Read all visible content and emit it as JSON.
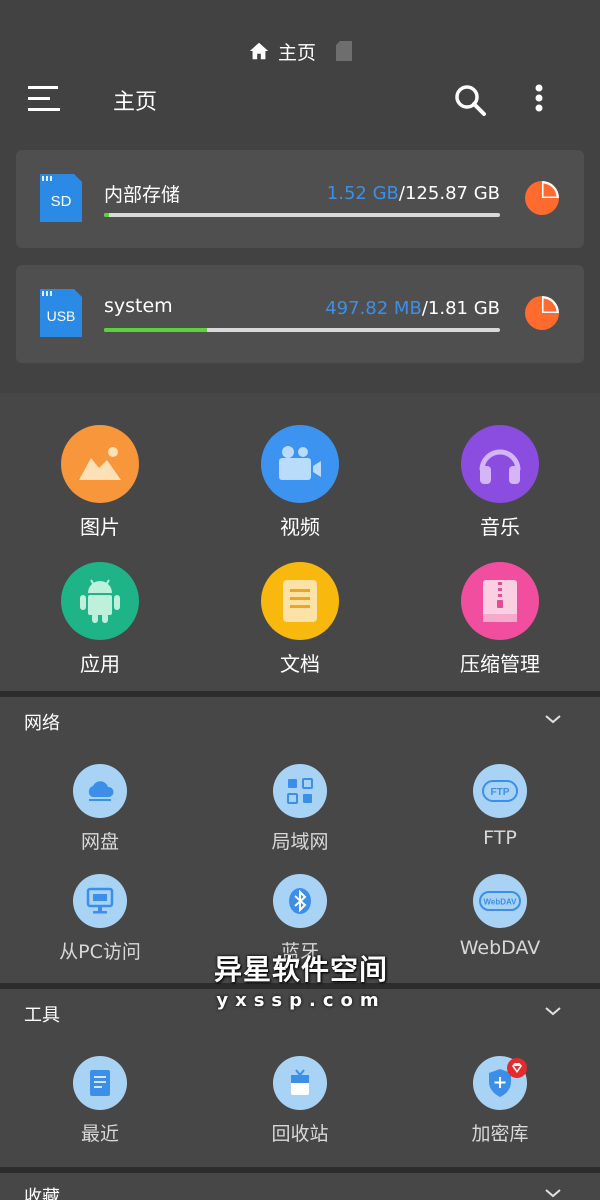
{
  "breadcrumb": {
    "home_label": "主页"
  },
  "toolbar": {
    "title": "主页"
  },
  "storage": [
    {
      "icon_text": "SD",
      "name": "内部存储",
      "used": "1.52 GB",
      "separator": "/",
      "total": "125.87 GB",
      "used_fraction": 0.012
    },
    {
      "icon_text": "USB",
      "name": "system",
      "used": "497.82 MB",
      "separator": "/",
      "total": "1.81 GB",
      "used_fraction": 0.26
    }
  ],
  "categories": [
    {
      "label": "图片",
      "color": "#f7963a",
      "icon": "image-icon"
    },
    {
      "label": "视频",
      "color": "#3d93f0",
      "icon": "video-icon"
    },
    {
      "label": "音乐",
      "color": "#8b4de0",
      "icon": "music-icon"
    },
    {
      "label": "应用",
      "color": "#1fb487",
      "icon": "android-icon"
    },
    {
      "label": "文档",
      "color": "#f8b80e",
      "icon": "document-icon"
    },
    {
      "label": "压缩管理",
      "color": "#f24ea0",
      "icon": "archive-icon"
    }
  ],
  "network": {
    "title": "网络",
    "items": [
      {
        "label": "网盘",
        "icon": "cloud-drive-icon"
      },
      {
        "label": "局域网",
        "icon": "lan-icon"
      },
      {
        "label": "FTP",
        "icon": "ftp-icon",
        "icon_text": "FTP"
      },
      {
        "label": "从PC访问",
        "icon": "pc-access-icon"
      },
      {
        "label": "蓝牙",
        "icon": "bluetooth-icon"
      },
      {
        "label": "WebDAV",
        "icon": "webdav-icon",
        "icon_text": "WebDAV"
      }
    ]
  },
  "tools": {
    "title": "工具",
    "items": [
      {
        "label": "最近",
        "icon": "recent-icon"
      },
      {
        "label": "回收站",
        "icon": "recycle-bin-icon"
      },
      {
        "label": "加密库",
        "icon": "vault-icon"
      }
    ]
  },
  "favorites": {
    "title": "收藏"
  },
  "watermark": {
    "main": "异星软件空间",
    "sub": "yxssp.com"
  },
  "colors": {
    "accent_blue": "#3c8fe8",
    "bar_green": "#5dd03c",
    "pie_orange": "#ff6a2f"
  }
}
